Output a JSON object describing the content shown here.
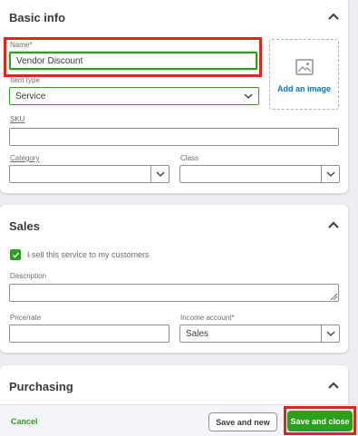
{
  "basic_info": {
    "title": "Basic info",
    "name_label": "Name*",
    "name_value": "Vendor Discount",
    "item_type_label": "Item type",
    "item_type_value": "Service",
    "add_image_label": "Add an image",
    "sku_label": "SKU",
    "sku_value": "",
    "category_label": "Category",
    "category_value": "",
    "class_label": "Class",
    "class_value": ""
  },
  "sales": {
    "title": "Sales",
    "checkbox_label": "I sell this service to my customers",
    "checkbox_checked": true,
    "description_label": "Description",
    "description_value": "",
    "price_label": "Price/rate",
    "price_value": "",
    "income_account_label": "Income account*",
    "income_account_value": "Sales"
  },
  "purchasing": {
    "title": "Purchasing"
  },
  "footer": {
    "cancel_label": "Cancel",
    "save_new_label": "Save and new",
    "save_close_label": "Save and close"
  },
  "colors": {
    "brand_green": "#2ca01c",
    "highlight_red": "#d52b1e",
    "link_blue": "#0077c5"
  },
  "icons": [
    "chevron-up-icon",
    "chevron-down-icon",
    "image-placeholder-icon",
    "checkmark-icon",
    "resize-handle-icon"
  ]
}
